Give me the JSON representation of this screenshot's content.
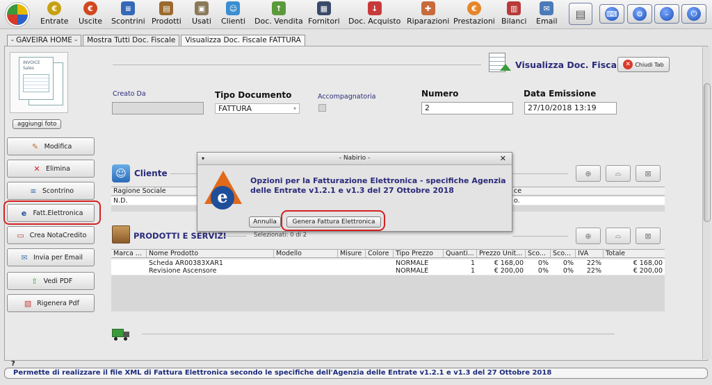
{
  "toolbar": {
    "items": [
      {
        "label": "Entrate",
        "icon": "coins-icon",
        "color": "#c7a012"
      },
      {
        "label": "Uscite",
        "icon": "coins-out-icon",
        "color": "#d0481f"
      },
      {
        "label": "Scontrini",
        "icon": "receipt-icon",
        "color": "#3568b7"
      },
      {
        "label": "Prodotti",
        "icon": "box-icon",
        "color": "#9a6a2e"
      },
      {
        "label": "Usati",
        "icon": "used-box-icon",
        "color": "#8a7a5a"
      },
      {
        "label": "Clienti",
        "icon": "client-icon",
        "color": "#3a8ed1"
      },
      {
        "label": "Doc. Vendita",
        "icon": "sales-doc-icon",
        "color": "#5a9a3a"
      },
      {
        "label": "Fornitori",
        "icon": "supplier-icon",
        "color": "#3a4a6a"
      },
      {
        "label": "Doc. Acquisto",
        "icon": "purchase-doc-icon",
        "color": "#c83a3a"
      },
      {
        "label": "Riparazioni",
        "icon": "repair-icon",
        "color": "#c86a3a"
      },
      {
        "label": "Prestazioni",
        "icon": "service-icon",
        "color": "#e6852a"
      },
      {
        "label": "Bilanci",
        "icon": "balance-icon",
        "color": "#b83a3a"
      },
      {
        "label": "Email",
        "icon": "email-icon",
        "color": "#4a7ab8"
      }
    ],
    "right_icons": [
      "cash-register-icon",
      "keyboard-icon",
      "settings-icon",
      "minimize-icon",
      "power-icon"
    ]
  },
  "tabs": [
    "- GAVEIRA HOME -",
    "Mostra Tutti Doc. Fiscale",
    "Visualizza Doc. Fiscale FATTURA"
  ],
  "sidebar": {
    "foto_label": "aggiungi foto",
    "invoice_text": [
      "INVOICE",
      "Sales"
    ],
    "buttons": [
      {
        "label": "Modifica",
        "icon": "pencil-icon"
      },
      {
        "label": "Elimina",
        "icon": "delete-icon"
      },
      {
        "label": "Scontrino",
        "icon": "receipt-icon"
      },
      {
        "label": "Fatt.Elettronica",
        "icon": "e-invoice-icon"
      },
      {
        "label": "Crea NotaCredito",
        "icon": "credit-note-icon"
      },
      {
        "label": "Invia per Email",
        "icon": "email-icon"
      },
      {
        "label": "Vedi PDF",
        "icon": "pdf-view-icon"
      },
      {
        "label": "Rigenera Pdf",
        "icon": "pdf-regenerate-icon"
      }
    ]
  },
  "header": {
    "title": "Visualizza Doc. Fiscale",
    "close_label": "Chiudi Tab"
  },
  "form": {
    "creato_da_label": "Creato Da",
    "creato_da_value": "",
    "tipo_label": "Tipo Documento",
    "tipo_value": "FATTURA",
    "accomp_label": "Accompagnatoria",
    "numero_label": "Numero",
    "numero_value": "2",
    "data_label": "Data Emissione",
    "data_value": "27/10/2018 13:19"
  },
  "cliente": {
    "title": "Cliente",
    "col_ragione": "Ragione Sociale",
    "col_right_fragment": "ce",
    "value_ragione": "N.D.",
    "value_right_fragment": "o."
  },
  "prodotti": {
    "title": "PRODOTTI E SERVIZI",
    "selected": "Selezionati: 0 di 2",
    "columns": [
      "Marca ...",
      "Nome Prodotto",
      "Modello",
      "Misure",
      "Colore",
      "Tipo Prezzo",
      "Quanti...",
      "Prezzo Unit...",
      "Sco...",
      "Sco...",
      "IVA",
      "Totale"
    ],
    "rows": [
      {
        "marca": "",
        "nome": "Scheda AR00383XAR1",
        "modello": "",
        "misure": "",
        "colore": "",
        "tipo": "NORMALE",
        "qta": "1",
        "prezzo": "€ 168,00",
        "sco1": "0%",
        "sco2": "0%",
        "iva": "22%",
        "totale": "€ 168,00"
      },
      {
        "marca": "",
        "nome": "Revisione Ascensore",
        "modello": "",
        "misure": "",
        "colore": "",
        "tipo": "NORMALE",
        "qta": "1",
        "prezzo": "€ 200,00",
        "sco1": "0%",
        "sco2": "0%",
        "iva": "22%",
        "totale": "€ 200,00"
      }
    ]
  },
  "dialog": {
    "title": "- Nabirio -",
    "message": "Opzioni per la Fatturazione Elettronica - specifiche Agenzia delle Entrate v1.2.1 e v1.3 del 27 Ottobre 2018",
    "cancel_label": "Annulla",
    "generate_label": "Genera Fattura Elettronica"
  },
  "status": {
    "help_mark": "?",
    "text": "Permette di realizzare il file XML di Fattura Elettronica secondo le specifiche dell'Agenzia delle Entrate v1.2.1 e v1.3 del 27 Ottobre 2018"
  },
  "colors": {
    "highlight": "#d42020",
    "accent_text": "#2a2a7a"
  }
}
